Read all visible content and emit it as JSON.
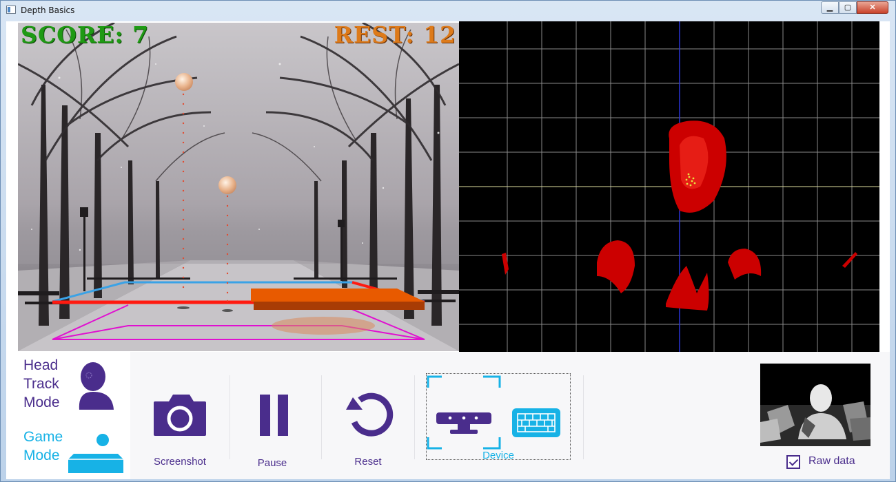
{
  "window": {
    "title": "Depth Basics",
    "minimize_icon": "minimize-icon",
    "maximize_icon": "maximize-icon",
    "close_icon": "close-icon"
  },
  "game": {
    "score_text": "SCORE: 7",
    "rest_text": "REST: 12",
    "score_color": "#1f9a14",
    "rest_color": "#dd7a1a"
  },
  "modes": {
    "head_track": {
      "label": "Head Track Mode",
      "line1": "Head",
      "line2": "Track",
      "line3": "Mode",
      "color": "#4a2d8c",
      "icon": "head-bust-icon"
    },
    "game": {
      "label": "Game Mode",
      "line1": "Game",
      "line2": "Mode",
      "color": "#17b2e6",
      "icon": "ball-paddle-icon"
    }
  },
  "toolbar": {
    "screenshot_label": "Screenshot",
    "pause_label": "Pause",
    "reset_label": "Reset",
    "device_label": "Device"
  },
  "raw_data": {
    "label": "Raw data",
    "checked": true
  },
  "colors": {
    "accent_purple": "#4a2d8c",
    "accent_cyan": "#17b2e6",
    "depth_red": "#cc0000"
  }
}
